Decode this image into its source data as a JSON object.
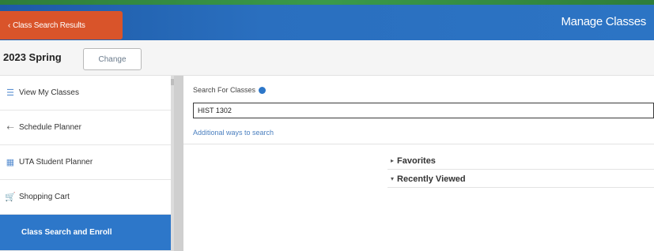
{
  "header": {
    "back_label": "Class Search Results",
    "title": "Manage Classes",
    "accent_color": "#2c74c4",
    "back_color": "#d9542a"
  },
  "term": {
    "label": "2023 Spring",
    "change_label": "Change"
  },
  "sidebar": {
    "items": [
      {
        "label": "View My Classes",
        "icon": "calendar-list-icon"
      },
      {
        "label": "Schedule Planner",
        "icon": "arrow-icon"
      },
      {
        "label": "UTA Student Planner",
        "icon": "grid-icon"
      },
      {
        "label": "Shopping Cart",
        "icon": "cart-icon"
      },
      {
        "label": "Class Search and Enroll",
        "icon": "",
        "active": true
      }
    ]
  },
  "search": {
    "label": "Search For Classes",
    "value": "HIST 1302",
    "additional_ways": "Additional ways to search"
  },
  "accordions": {
    "favorites": "Favorites",
    "recently_viewed": "Recently Viewed"
  }
}
